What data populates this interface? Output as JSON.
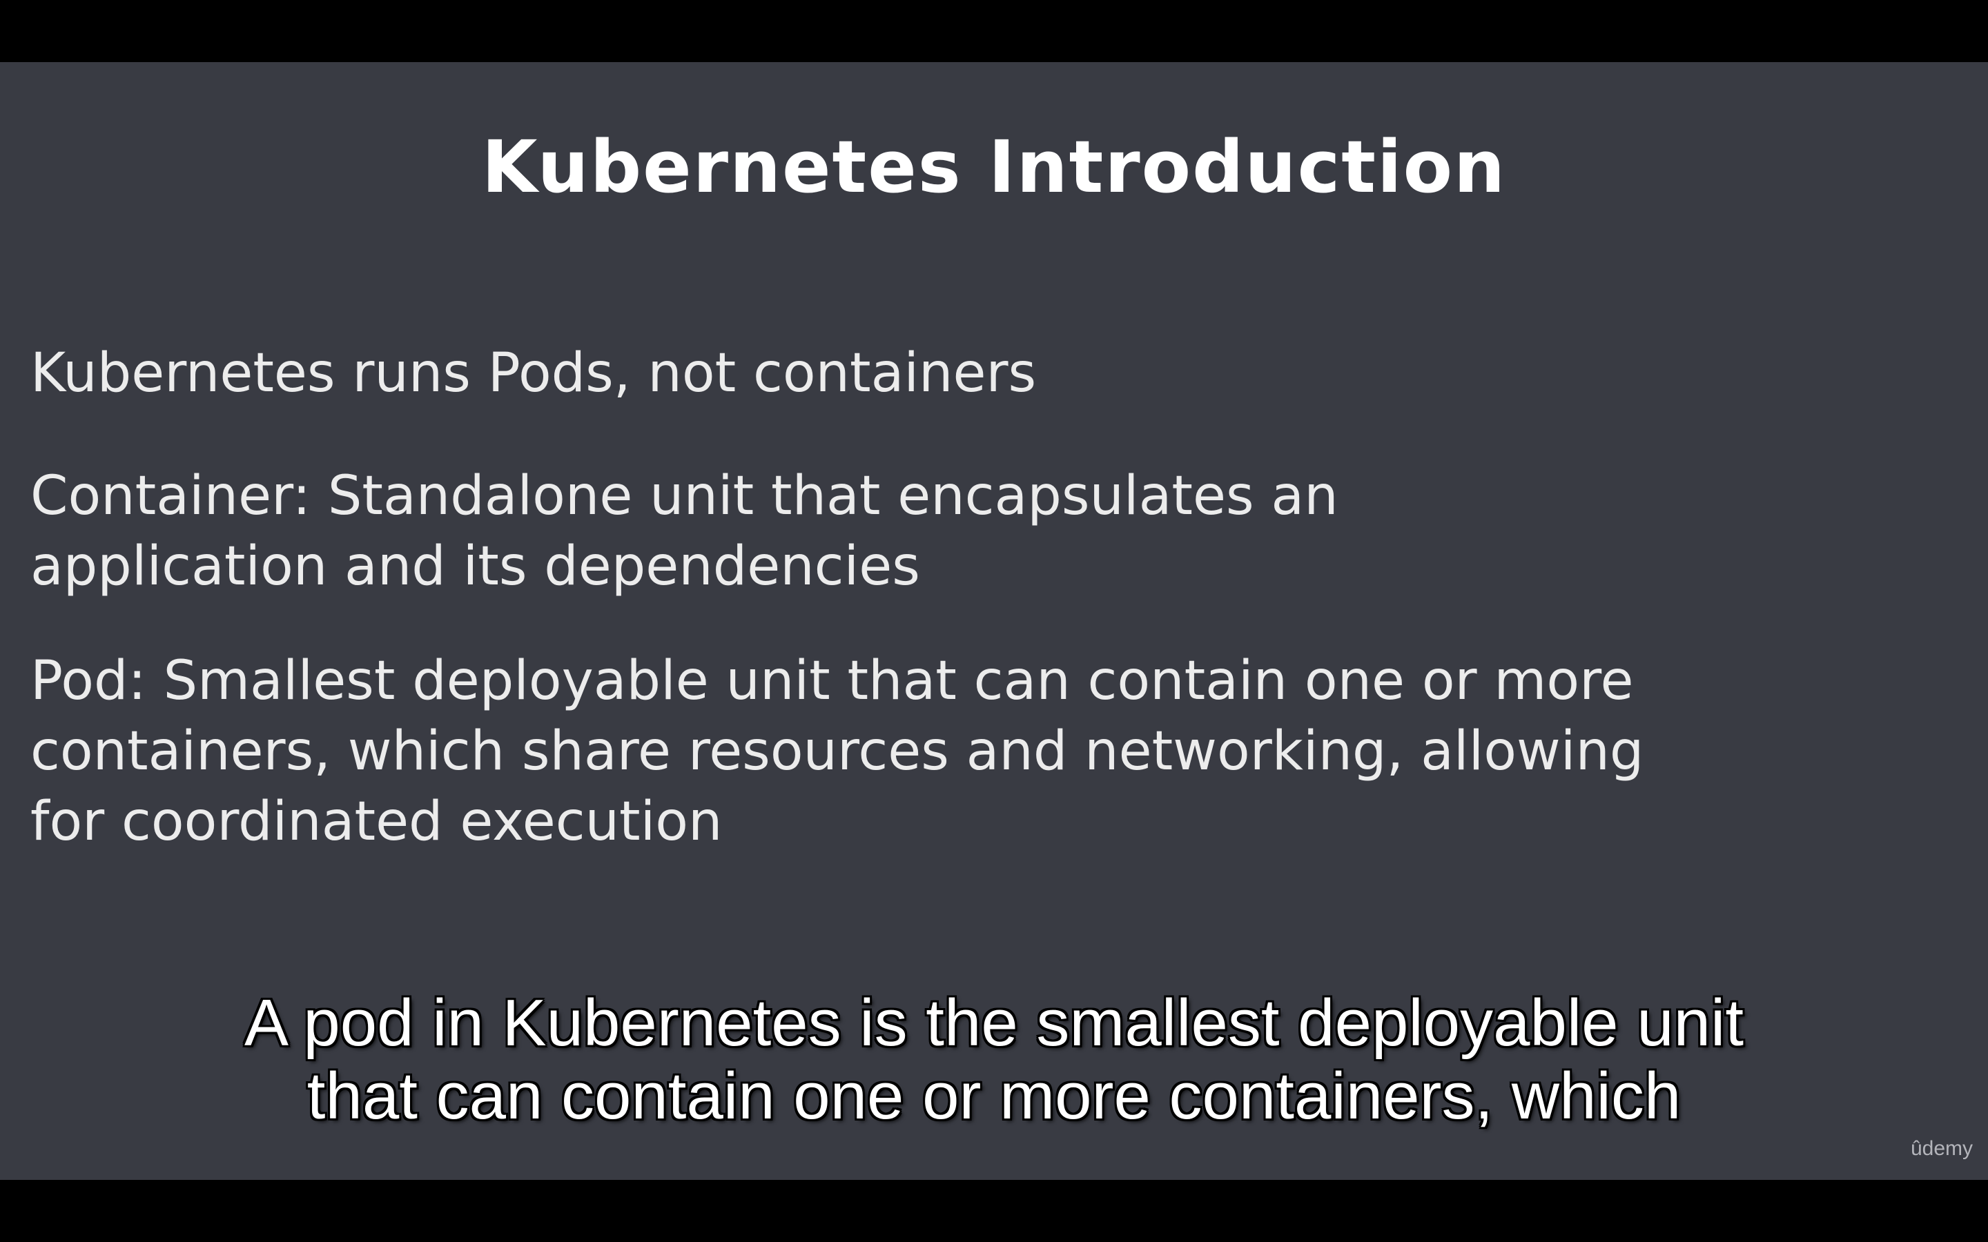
{
  "slide": {
    "title": "Kubernetes Introduction",
    "bullets": [
      {
        "lines": [
          "Kubernetes runs Pods, not containers"
        ]
      },
      {
        "lines": [
          "Container: Standalone unit that encapsulates an",
          "application and its dependencies"
        ]
      },
      {
        "lines": [
          "Pod: Smallest deployable unit that can contain one or more",
          "containers, which share resources and networking, allowing",
          "for coordinated execution"
        ]
      }
    ]
  },
  "caption": {
    "lines": [
      "A pod in Kubernetes is the smallest deployable unit",
      "that can contain one or more containers, which"
    ]
  },
  "watermark": "ûdemy",
  "colors": {
    "letterbox": "#000000",
    "slide_background": "#393b43",
    "title_text": "#ffffff",
    "body_text": "#ececec"
  }
}
